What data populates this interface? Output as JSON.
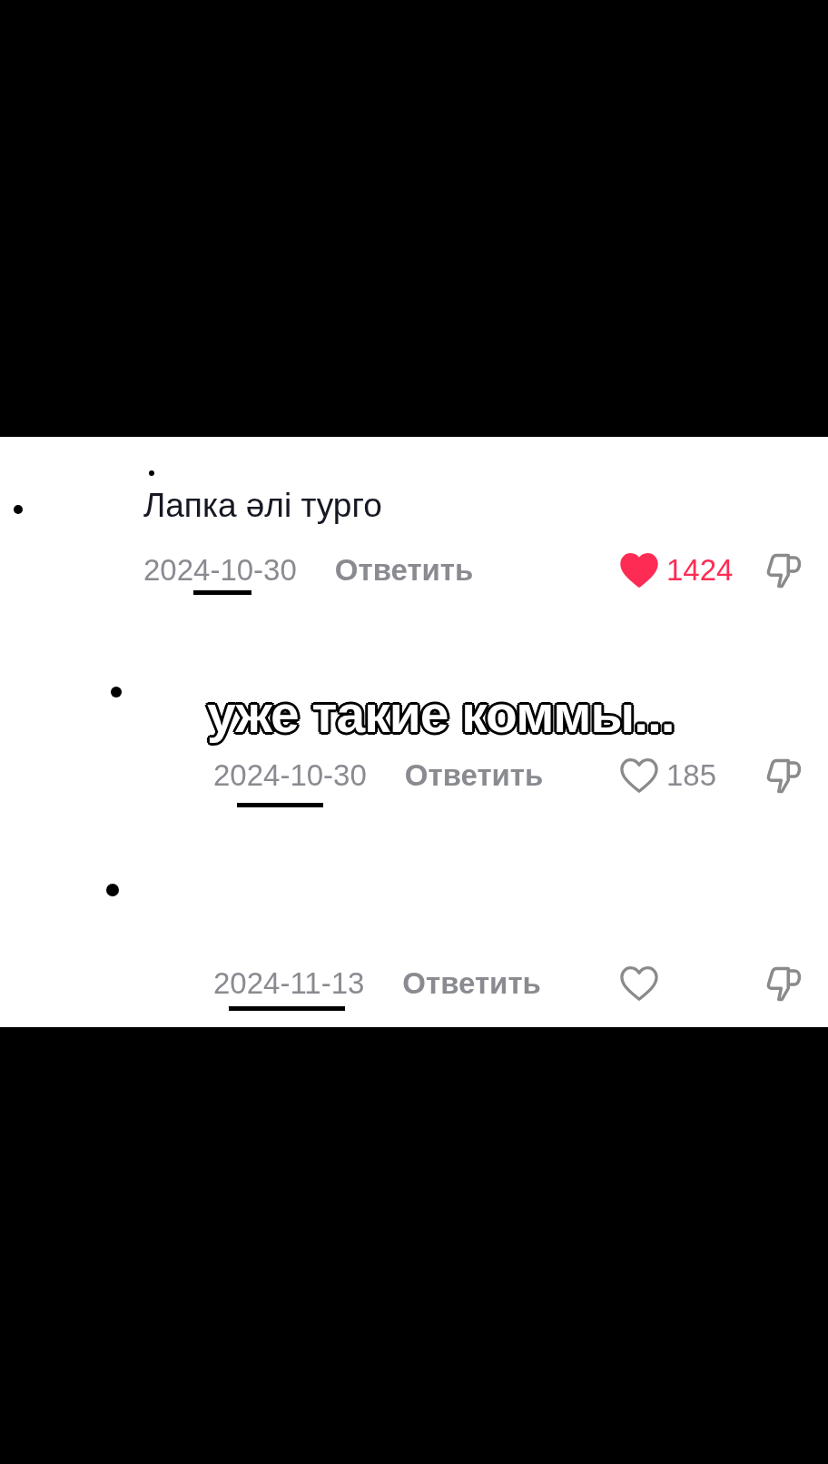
{
  "caption": "уже такие коммы...",
  "comments": [
    {
      "text": "Лапка әлі турго",
      "date": "2024-10-30",
      "reply": "Ответить",
      "liked": true,
      "likes": "1424",
      "children": [
        {
          "date": "2024-10-30",
          "reply": "Ответить",
          "liked": false,
          "likes": "185"
        },
        {
          "date": "2024-11-13",
          "reply": "Ответить",
          "liked": false
        }
      ]
    }
  ]
}
